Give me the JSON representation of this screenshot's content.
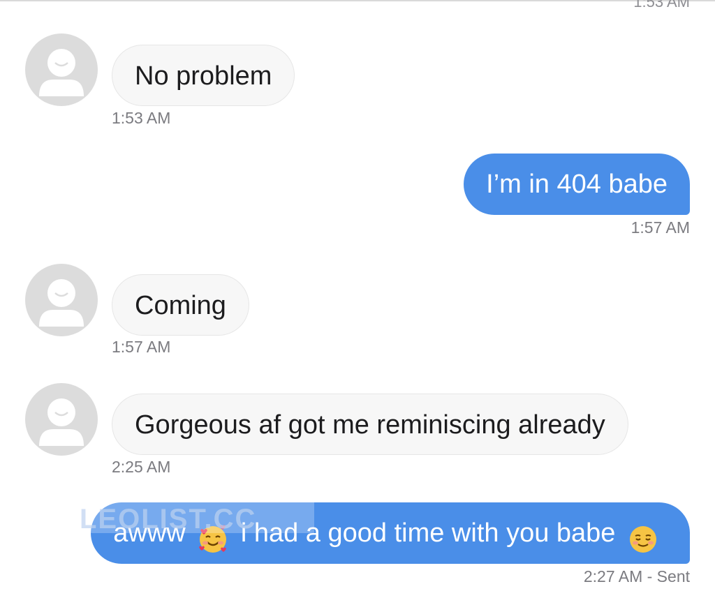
{
  "header": {
    "clipped_timestamp": "1:53 AM"
  },
  "messages": [
    {
      "direction": "incoming",
      "text": "No problem",
      "time": "1:53 AM"
    },
    {
      "direction": "outgoing",
      "text": "I’m in 404 babe",
      "time": "1:57 AM"
    },
    {
      "direction": "incoming",
      "text": "Coming",
      "time": "1:57 AM"
    },
    {
      "direction": "incoming",
      "text": "Gorgeous af got me reminiscing already",
      "time": "2:25 AM"
    },
    {
      "direction": "outgoing",
      "text_part1": "awww",
      "emoji1": "smiling-face-with-hearts-emoji",
      "text_part2": "i had a good time with you babe",
      "emoji2": "blushing-smile-emoji",
      "time": "2:27 AM - Sent"
    }
  ],
  "watermark": {
    "text": "LEOLIST.CC"
  },
  "colors": {
    "outgoing_bubble": "#4a8ee8",
    "incoming_bubble": "#f7f7f7",
    "timestamp": "#7b7b80",
    "avatar": "#dcdcdc"
  }
}
